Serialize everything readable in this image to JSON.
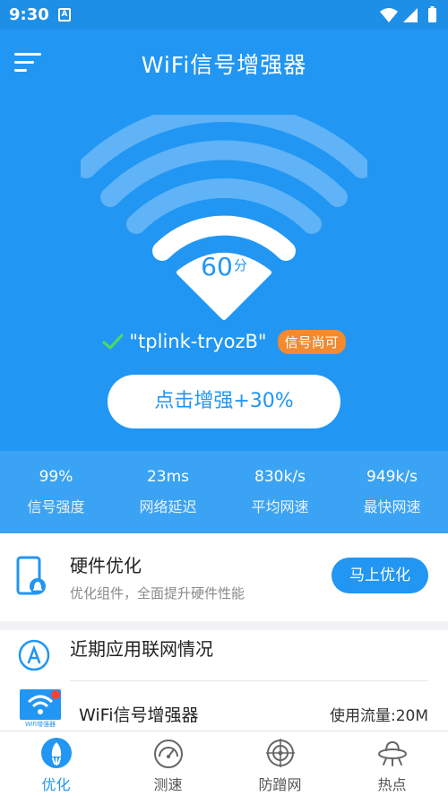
{
  "status_bar": {
    "time": "9:30",
    "badge": "A"
  },
  "header": {
    "title": "WiFi信号增强器",
    "menu_icon": "menu-icon"
  },
  "signal": {
    "score_value": "60",
    "score_unit": "分",
    "ssid": "\"tplink-tryozB\"",
    "quality_badge": "信号尚可",
    "boost_button": "点击增强+30%"
  },
  "stats": [
    {
      "value": "99%",
      "label": "信号强度"
    },
    {
      "value": "23ms",
      "label": "网络延迟"
    },
    {
      "value": "830k/s",
      "label": "平均网速"
    },
    {
      "value": "949k/s",
      "label": "最快网速"
    }
  ],
  "hardware": {
    "title": "硬件优化",
    "subtitle": "优化组件，全面提升硬件性能",
    "button": "马上优化"
  },
  "apps": {
    "title": "近期应用联网情况",
    "items": [
      {
        "name": "WiFi信号增强器",
        "usage": "使用流量:20M",
        "thumb_text": "Wifi增强器"
      }
    ]
  },
  "tabs": [
    {
      "label": "优化",
      "icon": "rocket-icon",
      "active": true
    },
    {
      "label": "测速",
      "icon": "speedometer-icon",
      "active": false
    },
    {
      "label": "防蹭网",
      "icon": "target-icon",
      "active": false
    },
    {
      "label": "热点",
      "icon": "ufo-icon",
      "active": false
    }
  ],
  "colors": {
    "primary": "#2196f3",
    "stats_bg": "#3ba3f3",
    "badge_orange": "#f28a2f",
    "check_green": "#4cd964"
  }
}
